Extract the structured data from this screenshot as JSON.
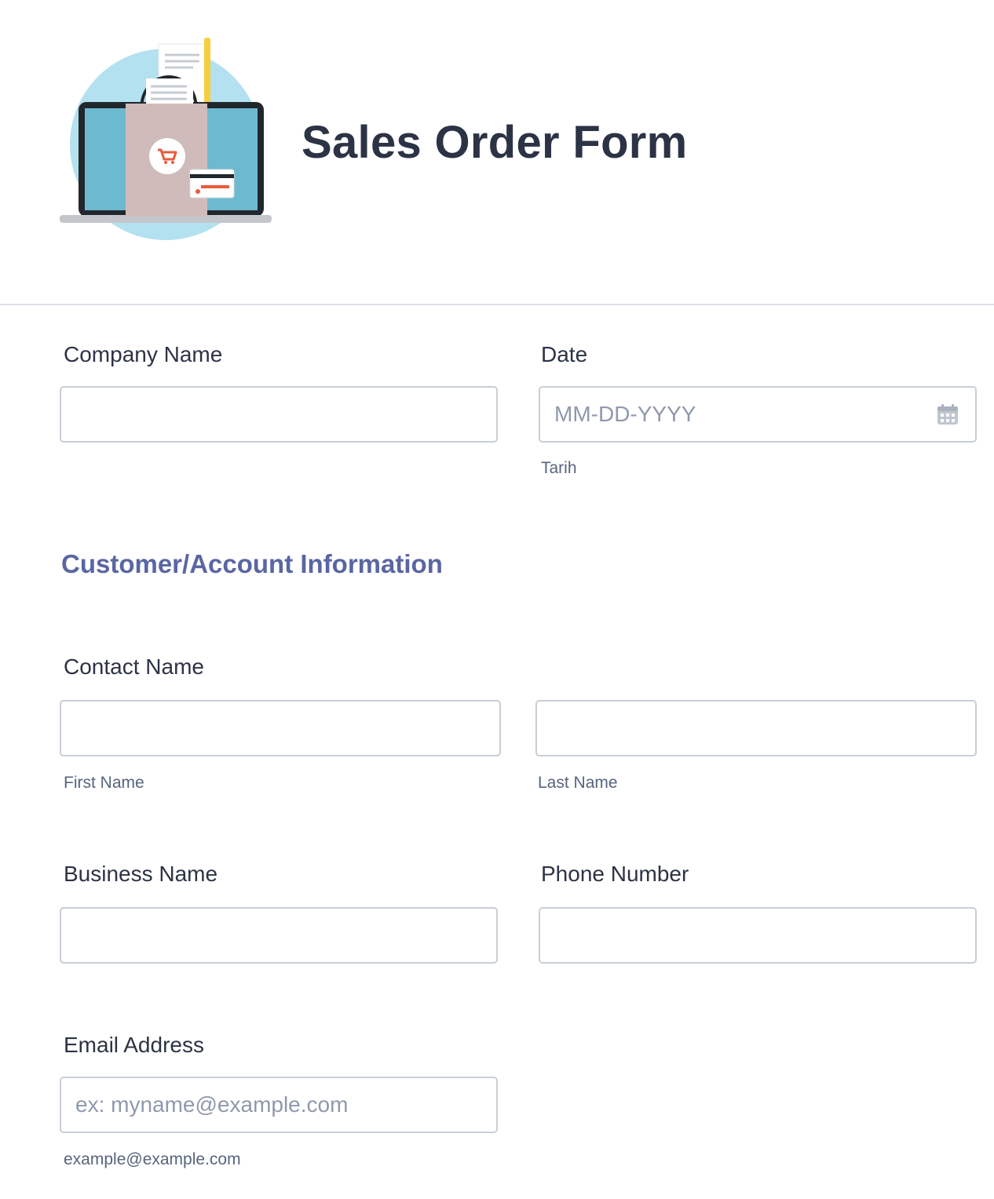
{
  "header": {
    "title": "Sales Order Form",
    "illustration": "shopping-bag-laptop-illustration"
  },
  "fields": {
    "company_name": {
      "label": "Company Name",
      "value": ""
    },
    "date": {
      "label": "Date",
      "placeholder": "MM-DD-YYYY",
      "sublabel": "Tarih",
      "icon": "calendar-icon"
    },
    "contact_name": {
      "label": "Contact Name",
      "first": {
        "value": "",
        "sublabel": "First Name"
      },
      "last": {
        "value": "",
        "sublabel": "Last Name"
      }
    },
    "business_name": {
      "label": "Business Name",
      "value": ""
    },
    "phone_number": {
      "label": "Phone Number",
      "value": ""
    },
    "email": {
      "label": "Email Address",
      "placeholder": "ex: myname@example.com",
      "sublabel": "example@example.com"
    }
  },
  "sections": {
    "customer_account": "Customer/Account Information"
  },
  "colors": {
    "title": "#2c3345",
    "section_heading": "#5a66a2",
    "input_border": "#c8ced6",
    "sublabel": "#57647e",
    "placeholder": "#8f99ad"
  }
}
